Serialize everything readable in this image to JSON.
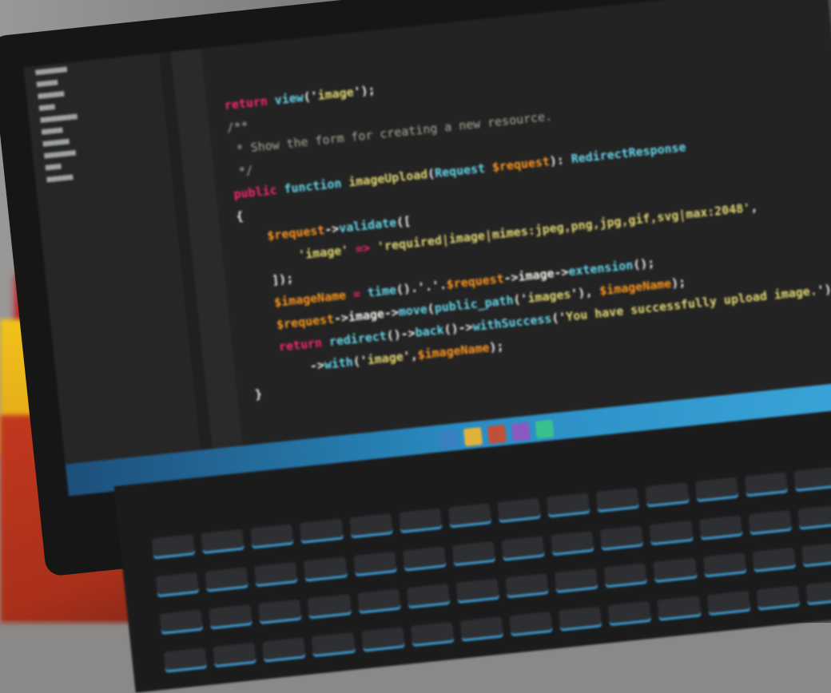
{
  "editor": {
    "lines": [
      {
        "parts": [
          {
            "t": "return ",
            "c": "kw"
          },
          {
            "t": "view",
            "c": "fn"
          },
          {
            "t": "('",
            "c": "plain"
          },
          {
            "t": "image",
            "c": "str"
          },
          {
            "t": "');",
            "c": "plain"
          }
        ]
      },
      {
        "parts": [
          {
            "t": "",
            "c": "plain"
          }
        ]
      },
      {
        "parts": [
          {
            "t": "/**",
            "c": "comment"
          }
        ]
      },
      {
        "parts": [
          {
            "t": " * Show the form for creating a new resource.",
            "c": "comment"
          }
        ]
      },
      {
        "parts": [
          {
            "t": " */",
            "c": "comment"
          }
        ]
      },
      {
        "parts": [
          {
            "t": "public ",
            "c": "kw"
          },
          {
            "t": "function ",
            "c": "fn"
          },
          {
            "t": "imageUpload",
            "c": "str"
          },
          {
            "t": "(",
            "c": "plain"
          },
          {
            "t": "Request ",
            "c": "fn"
          },
          {
            "t": "$request",
            "c": "var"
          },
          {
            "t": "): ",
            "c": "plain"
          },
          {
            "t": "RedirectResponse",
            "c": "fn"
          }
        ]
      },
      {
        "parts": [
          {
            "t": "{",
            "c": "plain"
          }
        ]
      },
      {
        "parts": [
          {
            "t": "    $request",
            "c": "var"
          },
          {
            "t": "->",
            "c": "plain"
          },
          {
            "t": "validate",
            "c": "fn"
          },
          {
            "t": "([",
            "c": "plain"
          }
        ]
      },
      {
        "parts": [
          {
            "t": "        'image'",
            "c": "str"
          },
          {
            "t": " => ",
            "c": "kw"
          },
          {
            "t": "'required|image|mimes:jpeg,png,jpg,gif,svg|max:2048'",
            "c": "str"
          },
          {
            "t": ",",
            "c": "plain"
          }
        ]
      },
      {
        "parts": [
          {
            "t": "    ]);",
            "c": "plain"
          }
        ]
      },
      {
        "parts": [
          {
            "t": "    $imageName",
            "c": "var"
          },
          {
            "t": " = ",
            "c": "kw"
          },
          {
            "t": "time",
            "c": "fn"
          },
          {
            "t": "().'.'.",
            "c": "plain"
          },
          {
            "t": "$request",
            "c": "var"
          },
          {
            "t": "->image->",
            "c": "plain"
          },
          {
            "t": "extension",
            "c": "fn"
          },
          {
            "t": "();",
            "c": "plain"
          }
        ]
      },
      {
        "parts": [
          {
            "t": "    $request",
            "c": "var"
          },
          {
            "t": "->image->",
            "c": "plain"
          },
          {
            "t": "move",
            "c": "fn"
          },
          {
            "t": "(",
            "c": "plain"
          },
          {
            "t": "public_path",
            "c": "fn"
          },
          {
            "t": "('",
            "c": "plain"
          },
          {
            "t": "images",
            "c": "str"
          },
          {
            "t": "'), ",
            "c": "plain"
          },
          {
            "t": "$imageName",
            "c": "var"
          },
          {
            "t": ");",
            "c": "plain"
          }
        ]
      },
      {
        "parts": [
          {
            "t": "    return ",
            "c": "kw"
          },
          {
            "t": "redirect",
            "c": "fn"
          },
          {
            "t": "()->",
            "c": "plain"
          },
          {
            "t": "back",
            "c": "fn"
          },
          {
            "t": "()->",
            "c": "plain"
          },
          {
            "t": "withSuccess",
            "c": "fn"
          },
          {
            "t": "('",
            "c": "plain"
          },
          {
            "t": "You have successfully upload image.",
            "c": "str"
          },
          {
            "t": "')",
            "c": "plain"
          }
        ]
      },
      {
        "parts": [
          {
            "t": "        ->",
            "c": "plain"
          },
          {
            "t": "with",
            "c": "fn"
          },
          {
            "t": "('",
            "c": "plain"
          },
          {
            "t": "image",
            "c": "str"
          },
          {
            "t": "',",
            "c": "plain"
          },
          {
            "t": "$imageName",
            "c": "var"
          },
          {
            "t": ");",
            "c": "plain"
          }
        ]
      },
      {
        "parts": [
          {
            "t": "}",
            "c": "plain"
          }
        ]
      }
    ]
  },
  "colors": {
    "keyword": "#f92672",
    "function": "#66d9ef",
    "string": "#e6db74",
    "variable": "#fd971f",
    "comment": "#a9ad9c",
    "editor_bg": "#232323",
    "taskbar_accent": "#2a8cc2"
  },
  "taskbar": {
    "icons": [
      "file-explorer-icon",
      "folder-icon",
      "media-icon",
      "browser-icon",
      "app-icon"
    ]
  }
}
